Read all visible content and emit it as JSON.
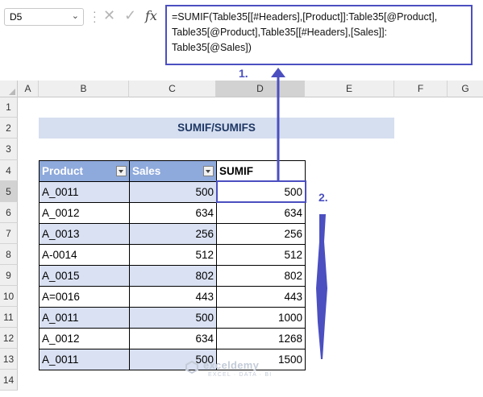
{
  "name_box": {
    "value": "D5"
  },
  "formula_bar": {
    "fx_label": "fx",
    "lines": [
      "=SUMIF(Table35[[#Headers],[Product]]:Table35[@Product],",
      "Table35[@Product],Table35[[#Headers],[Sales]]:",
      "Table35[@Sales])"
    ]
  },
  "columns": [
    "A",
    "B",
    "C",
    "D",
    "E",
    "F",
    "G"
  ],
  "rows": [
    "1",
    "2",
    "3",
    "4",
    "5",
    "6",
    "7",
    "8",
    "9",
    "10",
    "11",
    "12",
    "13",
    "14"
  ],
  "sheet_title": "SUMIF/SUMIFS",
  "table": {
    "headers": [
      "Product",
      "Sales",
      "SUMIF"
    ],
    "rows": [
      [
        "A_0011",
        "500",
        "500"
      ],
      [
        "A_0012",
        "634",
        "634"
      ],
      [
        "A_0013",
        "256",
        "256"
      ],
      [
        "A-0014",
        "512",
        "512"
      ],
      [
        "A_0015",
        "802",
        "802"
      ],
      [
        "A=0016",
        "443",
        "443"
      ],
      [
        "A_0011",
        "500",
        "1000"
      ],
      [
        "A_0012",
        "634",
        "1268"
      ],
      [
        "A_0011",
        "500",
        "1500"
      ]
    ]
  },
  "callouts": {
    "one": "1.",
    "two": "2."
  },
  "watermark": {
    "name": "exceldemy",
    "tagline": "EXCEL · DATA · BI"
  },
  "colors": {
    "accent": "#4b4fc0",
    "header_fill": "#8ea9db",
    "band_fill": "#d9e1f2",
    "title_fill": "#d6dff0"
  }
}
